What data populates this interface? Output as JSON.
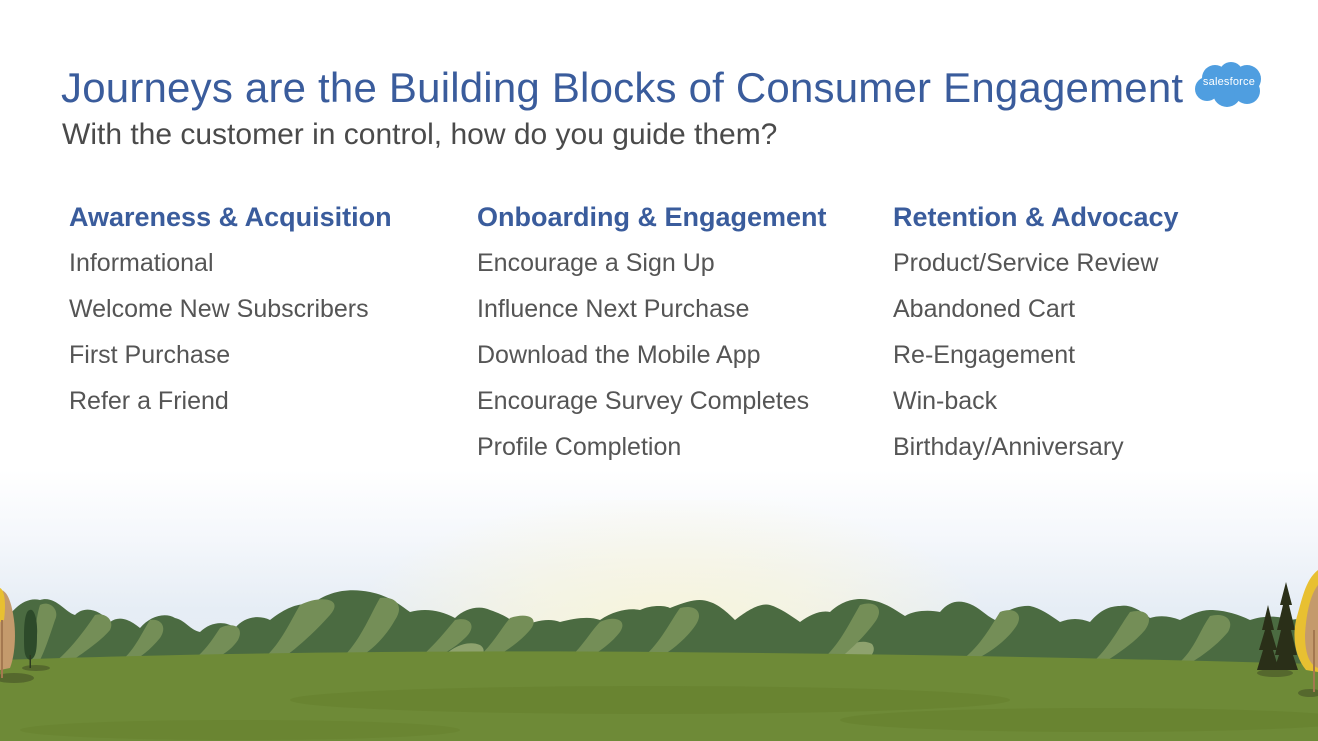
{
  "slide": {
    "title": "Journeys are the Building Blocks of Consumer Engagement",
    "subtitle": "With the customer in control, how do you guide them?",
    "logo": {
      "icon": "salesforce-cloud-logo",
      "text": "salesforce",
      "color": "#4f9ee0"
    },
    "colors": {
      "heading": "#3a5c9c",
      "body_text": "#555555",
      "grass": "#6e8a36",
      "hills_dark": "#4a6a40",
      "hills_light": "#7a9460"
    },
    "columns": [
      {
        "heading": "Awareness & Acquisition",
        "items": [
          "Informational",
          "Welcome New Subscribers",
          "First Purchase",
          "Refer a Friend"
        ]
      },
      {
        "heading": "Onboarding & Engagement",
        "items": [
          "Encourage a Sign Up",
          "Influence Next Purchase",
          "Download the Mobile App",
          "Encourage Survey Completes",
          "Profile Completion"
        ]
      },
      {
        "heading": "Retention & Advocacy",
        "items": [
          "Product/Service Review",
          "Abandoned Cart",
          "Re-Engagement",
          "Win-back",
          "Birthday/Anniversary"
        ]
      }
    ],
    "background_scene": "landscape-illustration"
  }
}
